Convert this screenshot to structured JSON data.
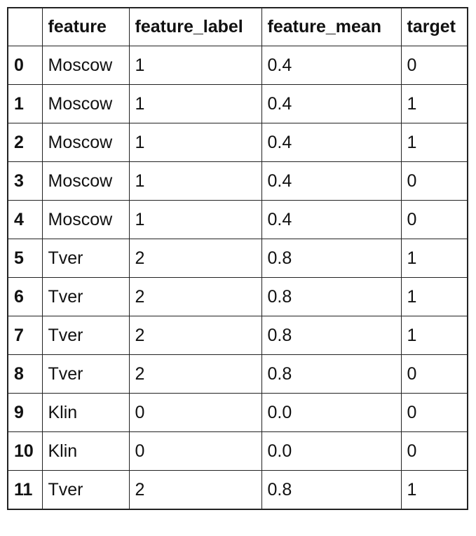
{
  "table": {
    "headers": [
      "",
      "feature",
      "feature_label",
      "feature_mean",
      "target"
    ],
    "rows": [
      {
        "index": "0",
        "feature": "Moscow",
        "feature_label": "1",
        "feature_mean": "0.4",
        "target": "0"
      },
      {
        "index": "1",
        "feature": "Moscow",
        "feature_label": "1",
        "feature_mean": "0.4",
        "target": "1"
      },
      {
        "index": "2",
        "feature": "Moscow",
        "feature_label": "1",
        "feature_mean": "0.4",
        "target": "1"
      },
      {
        "index": "3",
        "feature": "Moscow",
        "feature_label": "1",
        "feature_mean": "0.4",
        "target": "0"
      },
      {
        "index": "4",
        "feature": "Moscow",
        "feature_label": "1",
        "feature_mean": "0.4",
        "target": "0"
      },
      {
        "index": "5",
        "feature": "Tver",
        "feature_label": "2",
        "feature_mean": "0.8",
        "target": "1"
      },
      {
        "index": "6",
        "feature": "Tver",
        "feature_label": "2",
        "feature_mean": "0.8",
        "target": "1"
      },
      {
        "index": "7",
        "feature": "Tver",
        "feature_label": "2",
        "feature_mean": "0.8",
        "target": "1"
      },
      {
        "index": "8",
        "feature": "Tver",
        "feature_label": "2",
        "feature_mean": "0.8",
        "target": "0"
      },
      {
        "index": "9",
        "feature": "Klin",
        "feature_label": "0",
        "feature_mean": "0.0",
        "target": "0"
      },
      {
        "index": "10",
        "feature": "Klin",
        "feature_label": "0",
        "feature_mean": "0.0",
        "target": "0"
      },
      {
        "index": "11",
        "feature": "Tver",
        "feature_label": "2",
        "feature_mean": "0.8",
        "target": "1"
      }
    ]
  }
}
